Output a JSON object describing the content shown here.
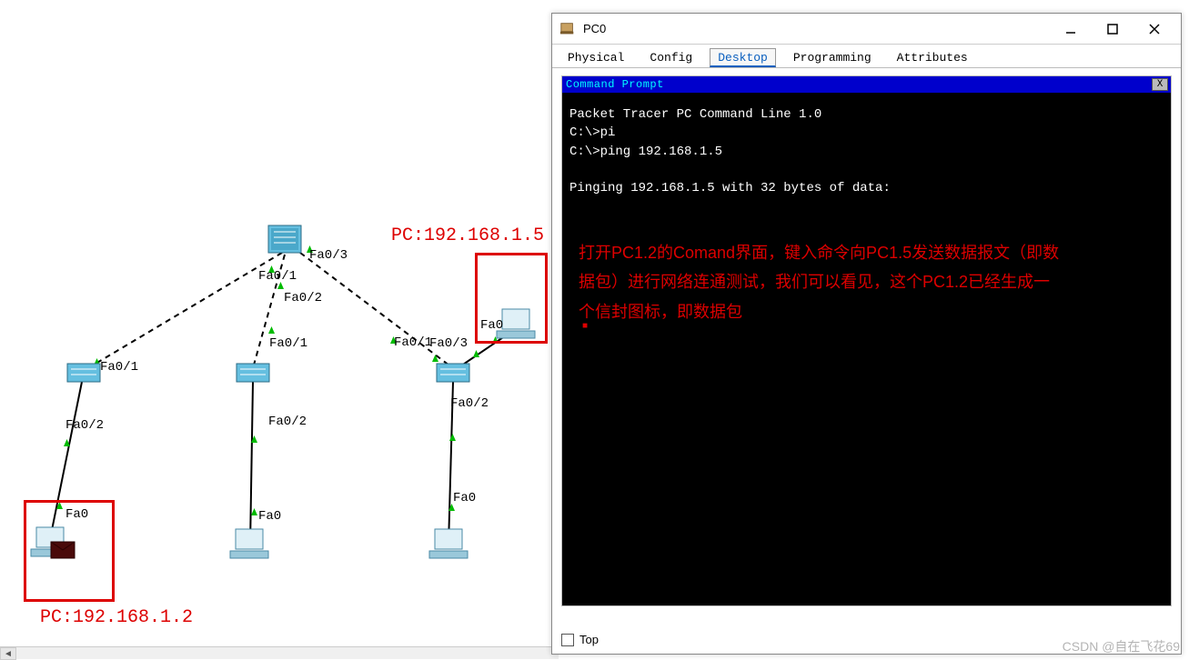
{
  "topology": {
    "port_labels": {
      "core_fa01": "Fa0/1",
      "core_fa02": "Fa0/2",
      "core_fa03": "Fa0/3",
      "sw1_up": "Fa0/1",
      "sw1_down": "Fa0/2",
      "sw2_up": "Fa0/1",
      "sw2_down": "Fa0/2",
      "sw3_up_a": "Fa0/1",
      "sw3_up_b": "Fa0/3",
      "sw3_down": "Fa0/2",
      "pc_left": "Fa0",
      "pc_mid": "Fa0",
      "pc_right": "Fa0",
      "pc_top": "Fa0"
    },
    "annotations": {
      "pc_left_ip": "PC:192.168.1.2",
      "pc_top_ip": "PC:192.168.1.5"
    }
  },
  "window": {
    "title": "PC0",
    "tabs": [
      "Physical",
      "Config",
      "Desktop",
      "Programming",
      "Attributes"
    ],
    "active_tab": "Desktop",
    "command_prompt_title": "Command Prompt",
    "close_x": "X",
    "terminal": {
      "line1": "Packet Tracer PC Command Line 1.0",
      "line2": "C:\\>pi",
      "line3": "C:\\>ping 192.168.1.5",
      "line4": "",
      "line5": "Pinging 192.168.1.5 with 32 bytes of data:"
    },
    "overlay_text": "打开PC1.2的Comand界面，键入命令向PC1.5发送数据报文（即数据包）进行网络连通测试，我们可以看见，这个PC1.2已经生成一个信封图标，即数据包",
    "overlay_dot": "■",
    "top_checkbox_label": "Top"
  },
  "watermark": "CSDN @自在飞花69"
}
